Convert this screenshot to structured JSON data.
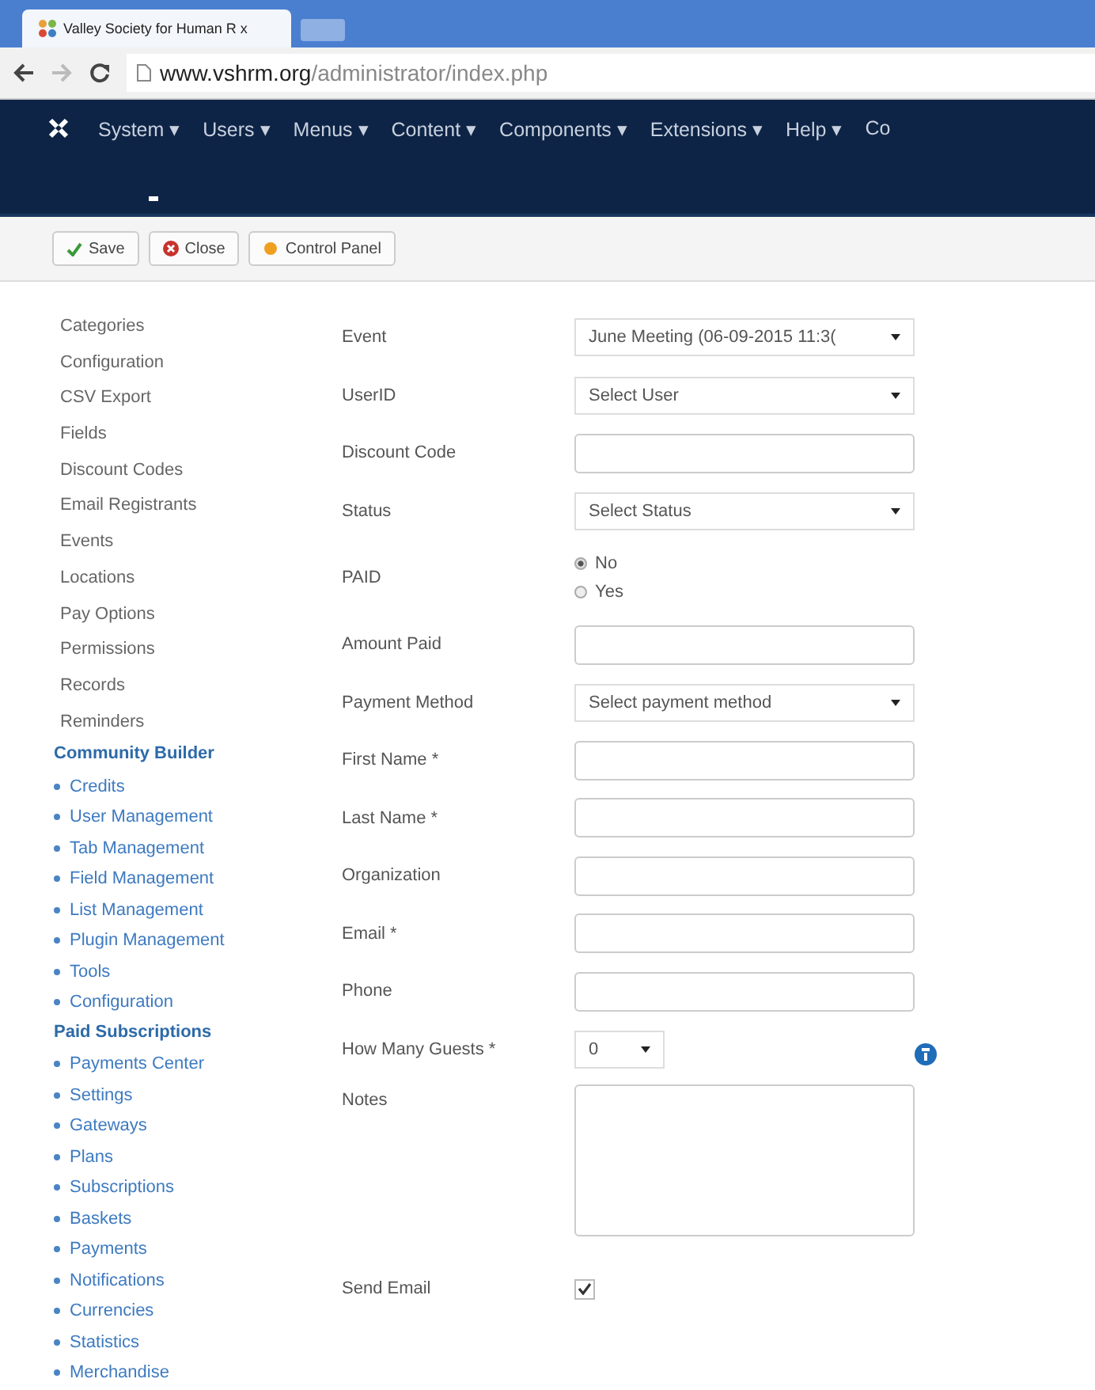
{
  "browser": {
    "tab_title": "Valley Society for Human R x",
    "url_host": "www.vshrm.org",
    "url_path": "/administrator/index.php"
  },
  "nav": [
    "System ▾",
    "Users ▾",
    "Menus ▾",
    "Content ▾",
    "Components ▾",
    "Extensions ▾",
    "Help ▾",
    "Co"
  ],
  "toolbar": [
    {
      "label": "Save",
      "kind": "save"
    },
    {
      "label": "Close",
      "kind": "close"
    },
    {
      "label": "Control Panel",
      "kind": "panel"
    }
  ],
  "sidebar": {
    "items": [
      "Categories",
      "Configuration",
      "CSV Export",
      "Fields",
      "Discount Codes",
      "Email Registrants",
      "Events",
      "Locations",
      "Pay Options",
      "Permissions",
      "Records",
      "Reminders"
    ],
    "groups": [
      {
        "title": "Community Builder",
        "items": [
          "Credits",
          "User Management",
          "Tab Management",
          "Field Management",
          "List Management",
          "Plugin Management",
          "Tools",
          "Configuration"
        ]
      },
      {
        "title": "Paid Subscriptions",
        "items": [
          "Payments Center",
          "Settings",
          "Gateways",
          "Plans",
          "Subscriptions",
          "Baskets",
          "Payments",
          "Notifications",
          "Currencies",
          "Statistics",
          "Merchandise"
        ]
      }
    ]
  },
  "form": [
    {
      "label": "Event",
      "kind": "select",
      "value": "June Meeting (06-09-2015 11:3("
    },
    {
      "label": "UserID",
      "kind": "select",
      "value": "Select User"
    },
    {
      "label": "Discount Code",
      "kind": "text"
    },
    {
      "label": "Status",
      "kind": "select",
      "value": "Select Status"
    },
    {
      "label": "PAID",
      "kind": "radio",
      "options": [
        {
          "label": "No",
          "selected": true
        },
        {
          "label": "Yes",
          "selected": false
        }
      ]
    },
    {
      "label": "Amount Paid",
      "kind": "text"
    },
    {
      "label": "Payment Method",
      "kind": "select",
      "value": "Select payment method"
    },
    {
      "label": "First Name *",
      "kind": "text"
    },
    {
      "label": "Last Name *",
      "kind": "text"
    },
    {
      "label": "Organization",
      "kind": "text"
    },
    {
      "label": "Email *",
      "kind": "text"
    },
    {
      "label": "Phone",
      "kind": "text"
    },
    {
      "label": "How Many Guests *",
      "kind": "small-select",
      "value": "0",
      "info": true
    },
    {
      "label": "Notes",
      "kind": "textarea"
    },
    {
      "label": "Send Email",
      "kind": "checkbox",
      "checked": true
    }
  ]
}
